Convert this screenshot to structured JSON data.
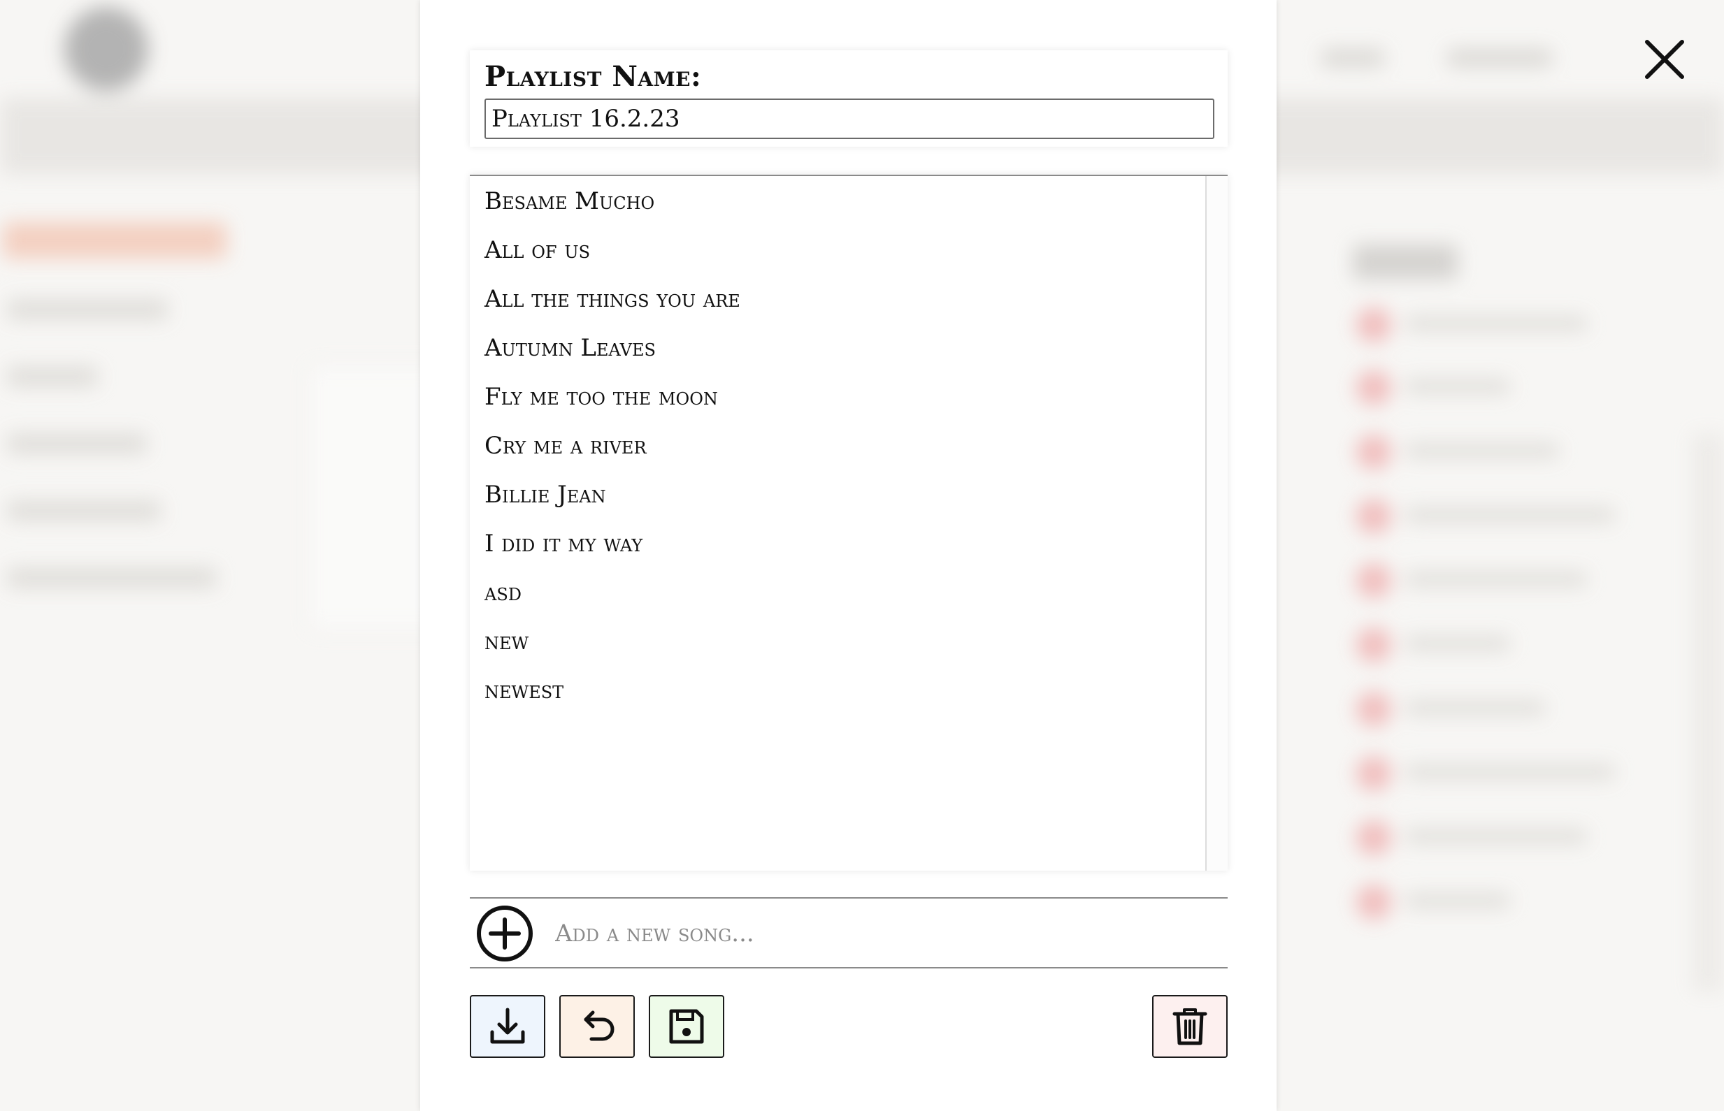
{
  "modal": {
    "name_label": "Playlist Name:",
    "name_value": "Playlist 16.2.23",
    "songs": [
      "Besame Mucho",
      "All of us",
      "All the things you are",
      "Autumn Leaves",
      "Fly me too the moon",
      "Cry me a river",
      "Billie Jean",
      "I did it my way",
      "asd",
      "new",
      "newest"
    ],
    "add_placeholder": "Add a new song...",
    "icons": {
      "close": "close-icon",
      "add": "plus-circle-icon",
      "download": "download-icon",
      "undo": "undo-icon",
      "save": "floppy-disk-icon",
      "delete": "trash-icon"
    },
    "colors": {
      "download_bg": "#eef5fd",
      "undo_bg": "#fdf1e6",
      "save_bg": "#eefbe9",
      "delete_bg": "#fdf0ef"
    }
  }
}
